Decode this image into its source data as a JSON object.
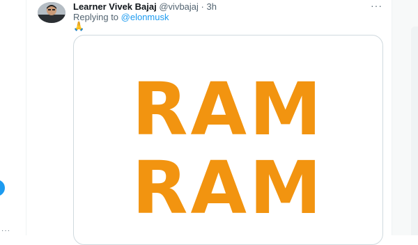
{
  "tweet": {
    "author_name": "Learner Vivek Bajaj",
    "handle": "@vivbajaj",
    "separator": "·",
    "time": "3h",
    "replying_prefix": "Replying to ",
    "replying_to": "@elonmusk",
    "emoji": "🙏",
    "more_glyph": "···",
    "image_text_line1": "RAM",
    "image_text_line2": "RAM"
  },
  "left_rail": {
    "more_glyph": "···"
  },
  "colors": {
    "accent": "#1d9bf0",
    "image_text": "#f29410",
    "secondary_text": "#536471"
  }
}
